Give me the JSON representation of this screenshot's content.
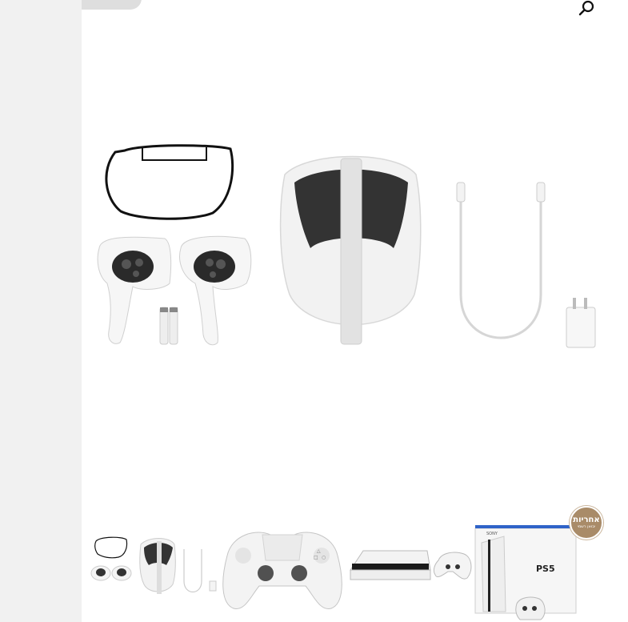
{
  "sidebar": {},
  "top_badge": {
    "label": ""
  },
  "search": {
    "icon": "search-icon"
  },
  "gallery": {
    "main_image": {
      "alt": ""
    },
    "thumbnails": [
      {
        "name": "thumbnail-vr-kit"
      },
      {
        "name": "thumbnail-controller"
      },
      {
        "name": "thumbnail-console-set"
      },
      {
        "name": "thumbnail-ps5-box"
      }
    ],
    "warranty_badge": {
      "line1": "אחריות",
      "line2": "יבואן רשמי"
    },
    "box_brand": "PS5",
    "box_maker": "SONY"
  },
  "colors": {
    "sidebar_bg": "#f1f1f1",
    "accent_badge": "#a98b68",
    "product_white": "#f4f4f4"
  }
}
